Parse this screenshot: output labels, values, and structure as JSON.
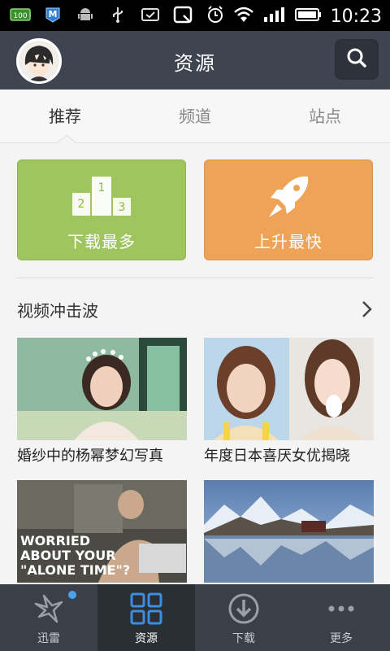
{
  "status_bar": {
    "battery_small_label": "100",
    "time": "10:23",
    "icons": [
      "battery-icon",
      "m-app-icon",
      "android-icon",
      "usb-icon",
      "checkbox-icon",
      "q-app-icon",
      "alarm-icon",
      "wifi-icon",
      "signal-icon",
      "battery-full-icon"
    ]
  },
  "header": {
    "title": "资源",
    "avatar_icon": "avatar",
    "search_icon": "search-icon"
  },
  "tabs": [
    {
      "label": "推荐",
      "active": true
    },
    {
      "label": "频道",
      "active": false
    },
    {
      "label": "站点",
      "active": false
    }
  ],
  "tiles": [
    {
      "label": "下载最多",
      "icon": "podium-icon",
      "color": "#9fc55f",
      "podium": [
        "1",
        "2",
        "3"
      ]
    },
    {
      "label": "上升最快",
      "icon": "rocket-icon",
      "color": "#eea356"
    }
  ],
  "section": {
    "title": "视频冲击波",
    "arrow_icon": "chevron-right-icon"
  },
  "cards": [
    {
      "caption": "婚纱中的杨幂梦幻写真"
    },
    {
      "caption": "年度日本喜厌女优揭晓"
    },
    {
      "caption": "",
      "overlay_text": [
        "WORRIED",
        "ABOUT YOUR",
        "\"ALONE TIME\"?"
      ]
    },
    {
      "caption": ""
    }
  ],
  "bottom_nav": [
    {
      "label": "迅雷",
      "icon": "thunder-bird-icon",
      "active": false,
      "badge": true
    },
    {
      "label": "资源",
      "icon": "grid-icon",
      "active": true
    },
    {
      "label": "下载",
      "icon": "download-icon",
      "active": false
    },
    {
      "label": "更多",
      "icon": "more-icon",
      "active": false
    }
  ]
}
